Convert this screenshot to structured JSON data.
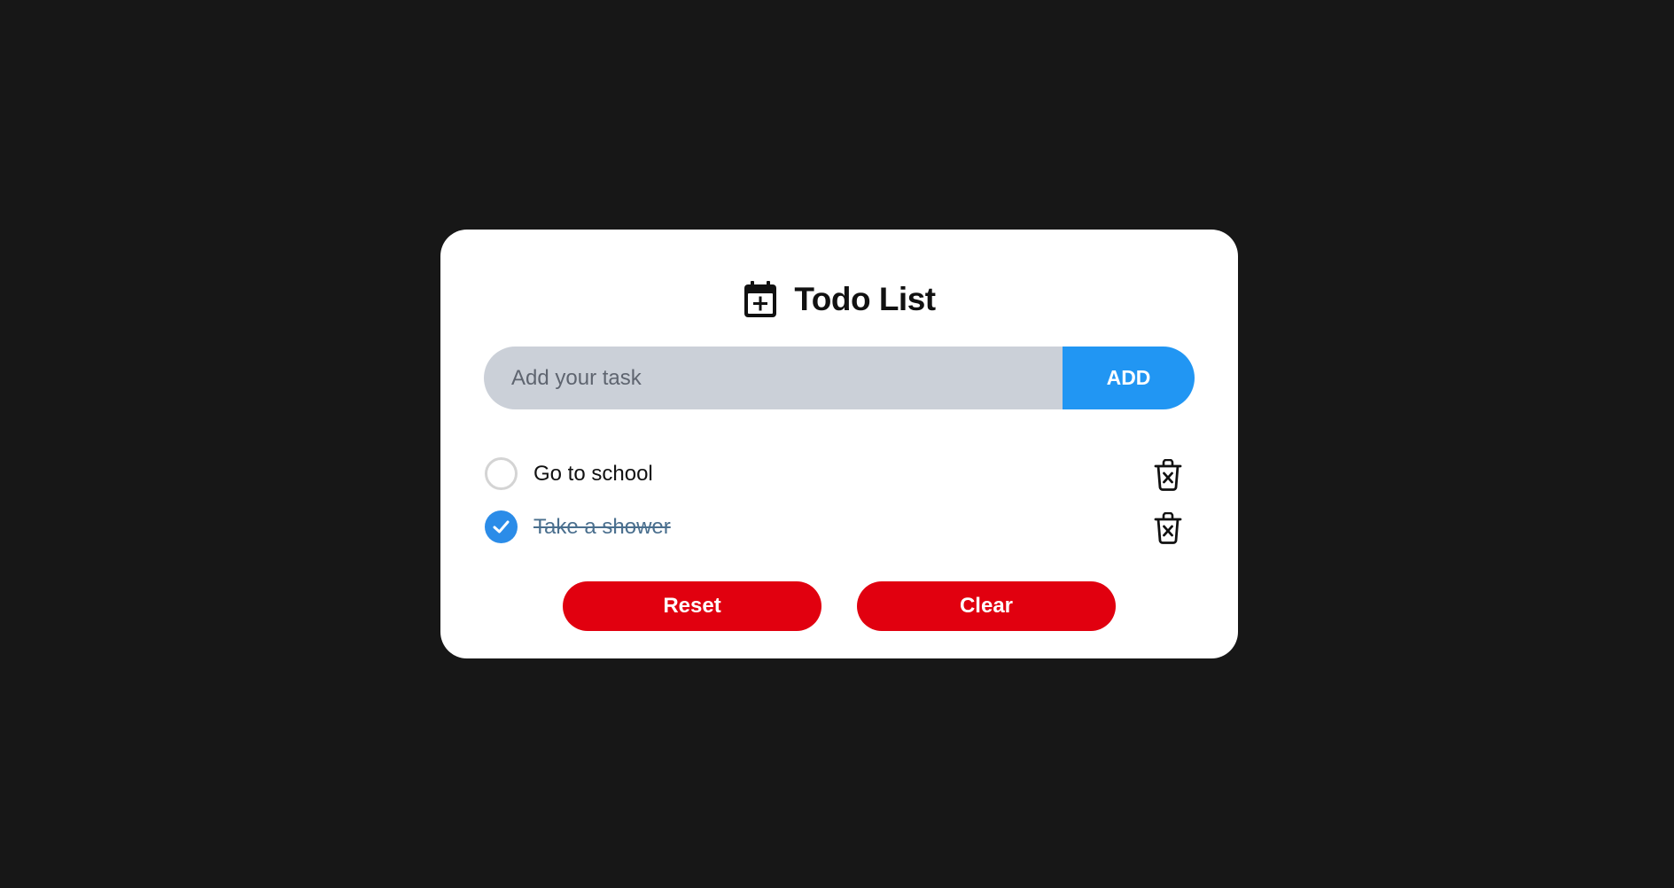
{
  "header": {
    "title": "Todo List",
    "icon": "calendar-plus-icon"
  },
  "input": {
    "placeholder": "Add your task",
    "value": "",
    "add_label": "ADD"
  },
  "tasks": [
    {
      "text": "Go to school",
      "completed": false
    },
    {
      "text": "Take a shower",
      "completed": true
    }
  ],
  "actions": {
    "reset_label": "Reset",
    "clear_label": "Clear"
  },
  "colors": {
    "background": "#171717",
    "card": "#ffffff",
    "accent": "#2196f3",
    "checked": "#2b8ce8",
    "danger": "#e1000f",
    "input_bg": "#cbd0d8"
  }
}
